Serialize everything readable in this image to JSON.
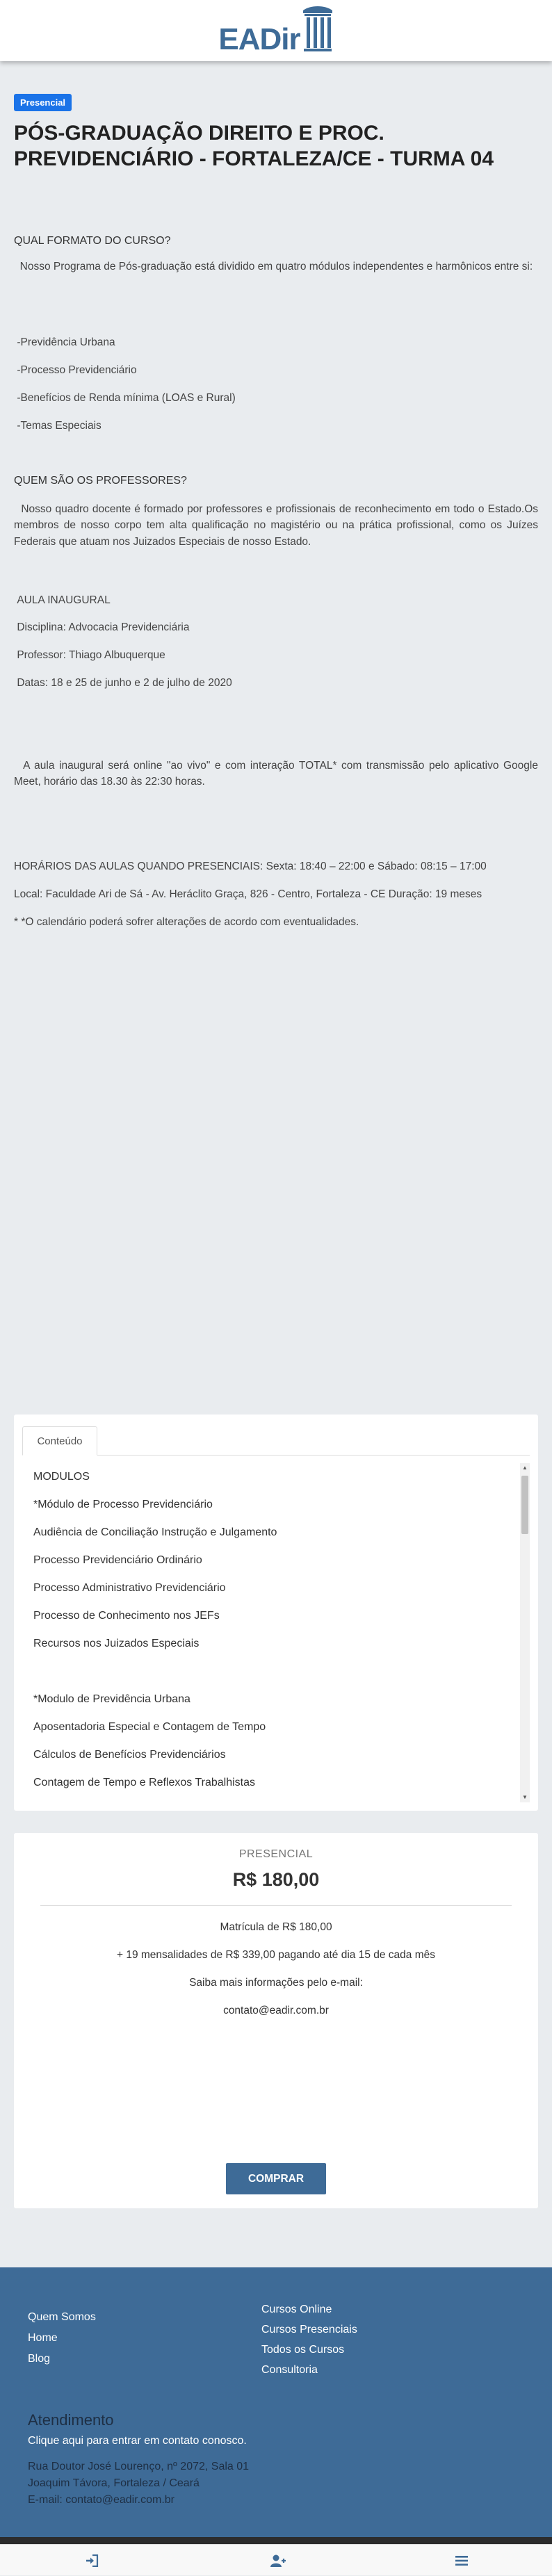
{
  "brand": {
    "logo_text": "EADir",
    "color": "#3e6b97"
  },
  "course": {
    "badge": "Presencial",
    "badge_color": "#1a73e8",
    "title": "PÓS-GRADUAÇÃO DIREITO E PROC. PREVIDENCIÁRIO - FORTALEZA/CE - TURMA 04"
  },
  "description": {
    "format_question": "QUAL FORMATO DO CURSO?",
    "format_answer": "Nosso Programa de Pós-graduação está dividido em quatro módulos independentes e harmônicos entre si:",
    "modules": [
      "-Previdência Urbana",
      "-Processo Previdenciário",
      "-Benefícios de Renda mínima (LOAS e Rural)",
      "-Temas Especiais"
    ],
    "teachers_question": "QUEM SÃO OS PROFESSORES?",
    "teachers_answer": "Nosso quadro docente é formado por professores e profissionais de reconhecimento em todo o Estado.Os membros de nosso corpo tem alta qualificação no magistério ou na prática profissional, como os Juízes Federais que atuam nos Juizados Especiais de nosso Estado.",
    "inaugural_title": "AULA INAUGURAL",
    "inaugural_discipline": "Disciplina: Advocacia Previdenciária",
    "inaugural_teacher": "Professor: Thiago Albuquerque",
    "inaugural_dates": "Datas: 18 e 25 de junho e 2 de julho de 2020",
    "inaugural_online": "A aula inaugural será online \"ao vivo\" e com interação TOTAL* com transmissão pelo aplicativo Google Meet, horário das 18.30 às 22:30 horas.",
    "schedule": "HORÁRIOS DAS AULAS QUANDO PRESENCIAIS: Sexta: 18:40 – 22:00 e Sábado: 08:15 – 17:00",
    "location": "Local: Faculdade Ari de Sá - Av. Heráclito Graça, 826 - Centro, Fortaleza - CE Duração: 19 meses",
    "note": "* *O calendário poderá sofrer alterações de acordo com eventualidades."
  },
  "content_tab": {
    "tab_label": "Conteúdo",
    "items": [
      "MODULOS",
      "*Módulo de Processo Previdenciário",
      "Audiência de Conciliação Instrução e Julgamento",
      "Processo Previdenciário Ordinário",
      "Processo Administrativo Previdenciário",
      "Processo de Conhecimento nos JEFs",
      "Recursos nos Juizados Especiais",
      "",
      "*Modulo de Previdência Urbana",
      "Aposentadoria Especial e Contagem de Tempo",
      "Cálculos de Benefícios Previdenciários",
      "Contagem de Tempo e Reflexos Trabalhistas"
    ]
  },
  "pricing": {
    "type": "PRESENCIAL",
    "price": "R$ 180,00",
    "enrollment": "Matrícula de R$ 180,00",
    "installments": "+ 19 mensalidades de R$ 339,00 pagando até dia 15 de cada mês",
    "more_info": "Saiba mais informações pelo e-mail:",
    "email": "contato@eadir.com.br",
    "buy_label": "COMPRAR"
  },
  "footer": {
    "links_left": [
      "Quem Somos",
      "Home",
      "Blog"
    ],
    "links_right": [
      "Cursos Online",
      "Cursos Presenciais",
      "Todos os Cursos",
      "Consultoria"
    ],
    "support_title": "Atendimento",
    "support_cta": "Clique aqui para entrar em contato conosco.",
    "address_lines": [
      "Rua Doutor José Lourenço, nº 2072, Sala 01",
      "Joaquim Távora, Fortaleza / Ceará",
      "E-mail: contato@eadir.com.br"
    ]
  },
  "bottom_nav": {
    "icons": [
      "sign-in-icon",
      "add-user-icon",
      "menu-icon"
    ]
  }
}
